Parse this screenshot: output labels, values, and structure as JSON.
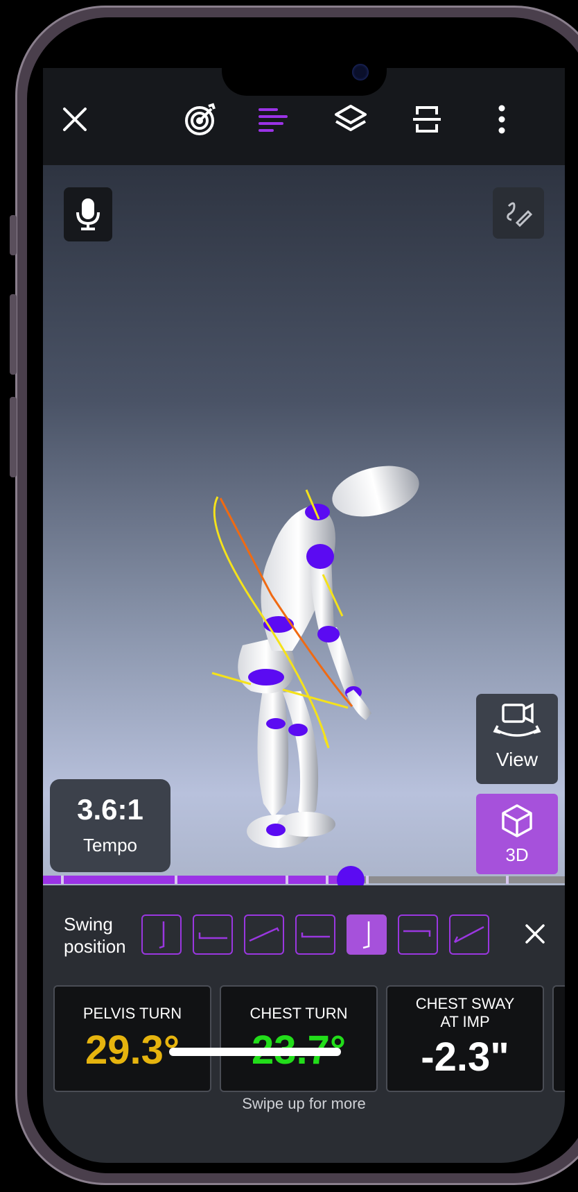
{
  "toolbar": {
    "icons": [
      "close-icon",
      "target-icon",
      "lines-icon",
      "layers-icon",
      "crop-icon",
      "more-vertical-icon"
    ],
    "accent": "#9b33e6"
  },
  "viewport": {
    "mic_icon": "microphone-icon",
    "draw_icon": "pencil-draw-icon",
    "tempo": {
      "value": "3.6:1",
      "label": "Tempo"
    },
    "view_button": {
      "label": "View",
      "icon": "camera-rotate-icon"
    },
    "mode_button": {
      "label": "3D",
      "icon": "cube-icon",
      "color": "#a651db"
    }
  },
  "scrubber": {
    "progress": 0.59,
    "fill_color": "#9b33e6",
    "knob_color": "#5b0bf2"
  },
  "swing_position": {
    "label_line1": "Swing",
    "label_line2": "position",
    "positions": 7,
    "active_index": 4
  },
  "metrics": [
    {
      "title": "PELVIS TURN",
      "value": "29.3°",
      "color": "#e6b40e"
    },
    {
      "title": "CHEST TURN",
      "value": "23.7°",
      "color": "#22dd1a"
    },
    {
      "title_line1": "CHEST SWAY",
      "title_line2": "AT IMP",
      "value": "-2.3\"",
      "color": "#ffffff"
    }
  ],
  "footer": {
    "swipe_hint": "Swipe up for more"
  }
}
